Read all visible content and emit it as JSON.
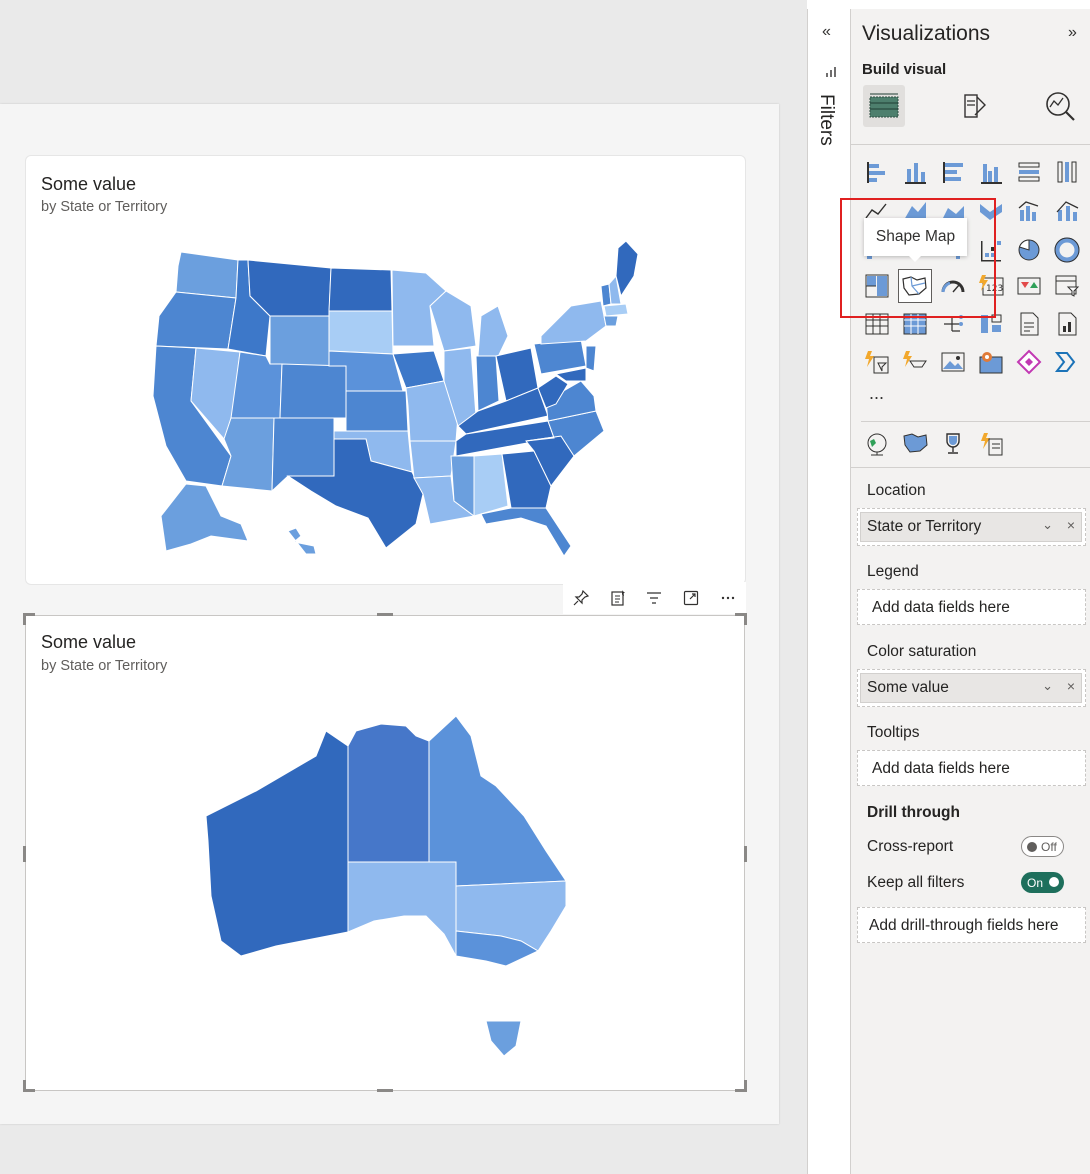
{
  "visuals": [
    {
      "title": "Some value",
      "subtitle": "by State or Territory"
    },
    {
      "title": "Some value",
      "subtitle": "by State or Territory"
    }
  ],
  "visual_toolbar": [
    "pin-icon",
    "copy-visual-icon",
    "filter-icon",
    "focus-mode-icon",
    "more-options-icon"
  ],
  "filters_pane": {
    "label": "Filters"
  },
  "viz_pane": {
    "title": "Visualizations",
    "build_visual": "Build visual",
    "modes": [
      "build-visual-icon",
      "format-visual-icon",
      "analytics-icon"
    ],
    "tooltip": "Shape Map",
    "more": "...",
    "sections": {
      "location": {
        "label": "Location",
        "field": "State or Territory"
      },
      "legend": {
        "label": "Legend",
        "placeholder": "Add data fields here"
      },
      "color_saturation": {
        "label": "Color saturation",
        "field": "Some value"
      },
      "tooltips": {
        "label": "Tooltips",
        "placeholder": "Add data fields here"
      },
      "drill_through": {
        "label": "Drill through",
        "cross_report": {
          "label": "Cross-report",
          "state": "Off"
        },
        "keep_all_filters": {
          "label": "Keep all filters",
          "state": "On"
        },
        "placeholder": "Add drill-through fields here"
      }
    }
  },
  "colors": {
    "map_light": "#a8cdf5",
    "map_mid": "#6b9fde",
    "map_dark": "#3169bd",
    "toggle_on": "#1e6f5c",
    "highlight": "#e02020"
  }
}
